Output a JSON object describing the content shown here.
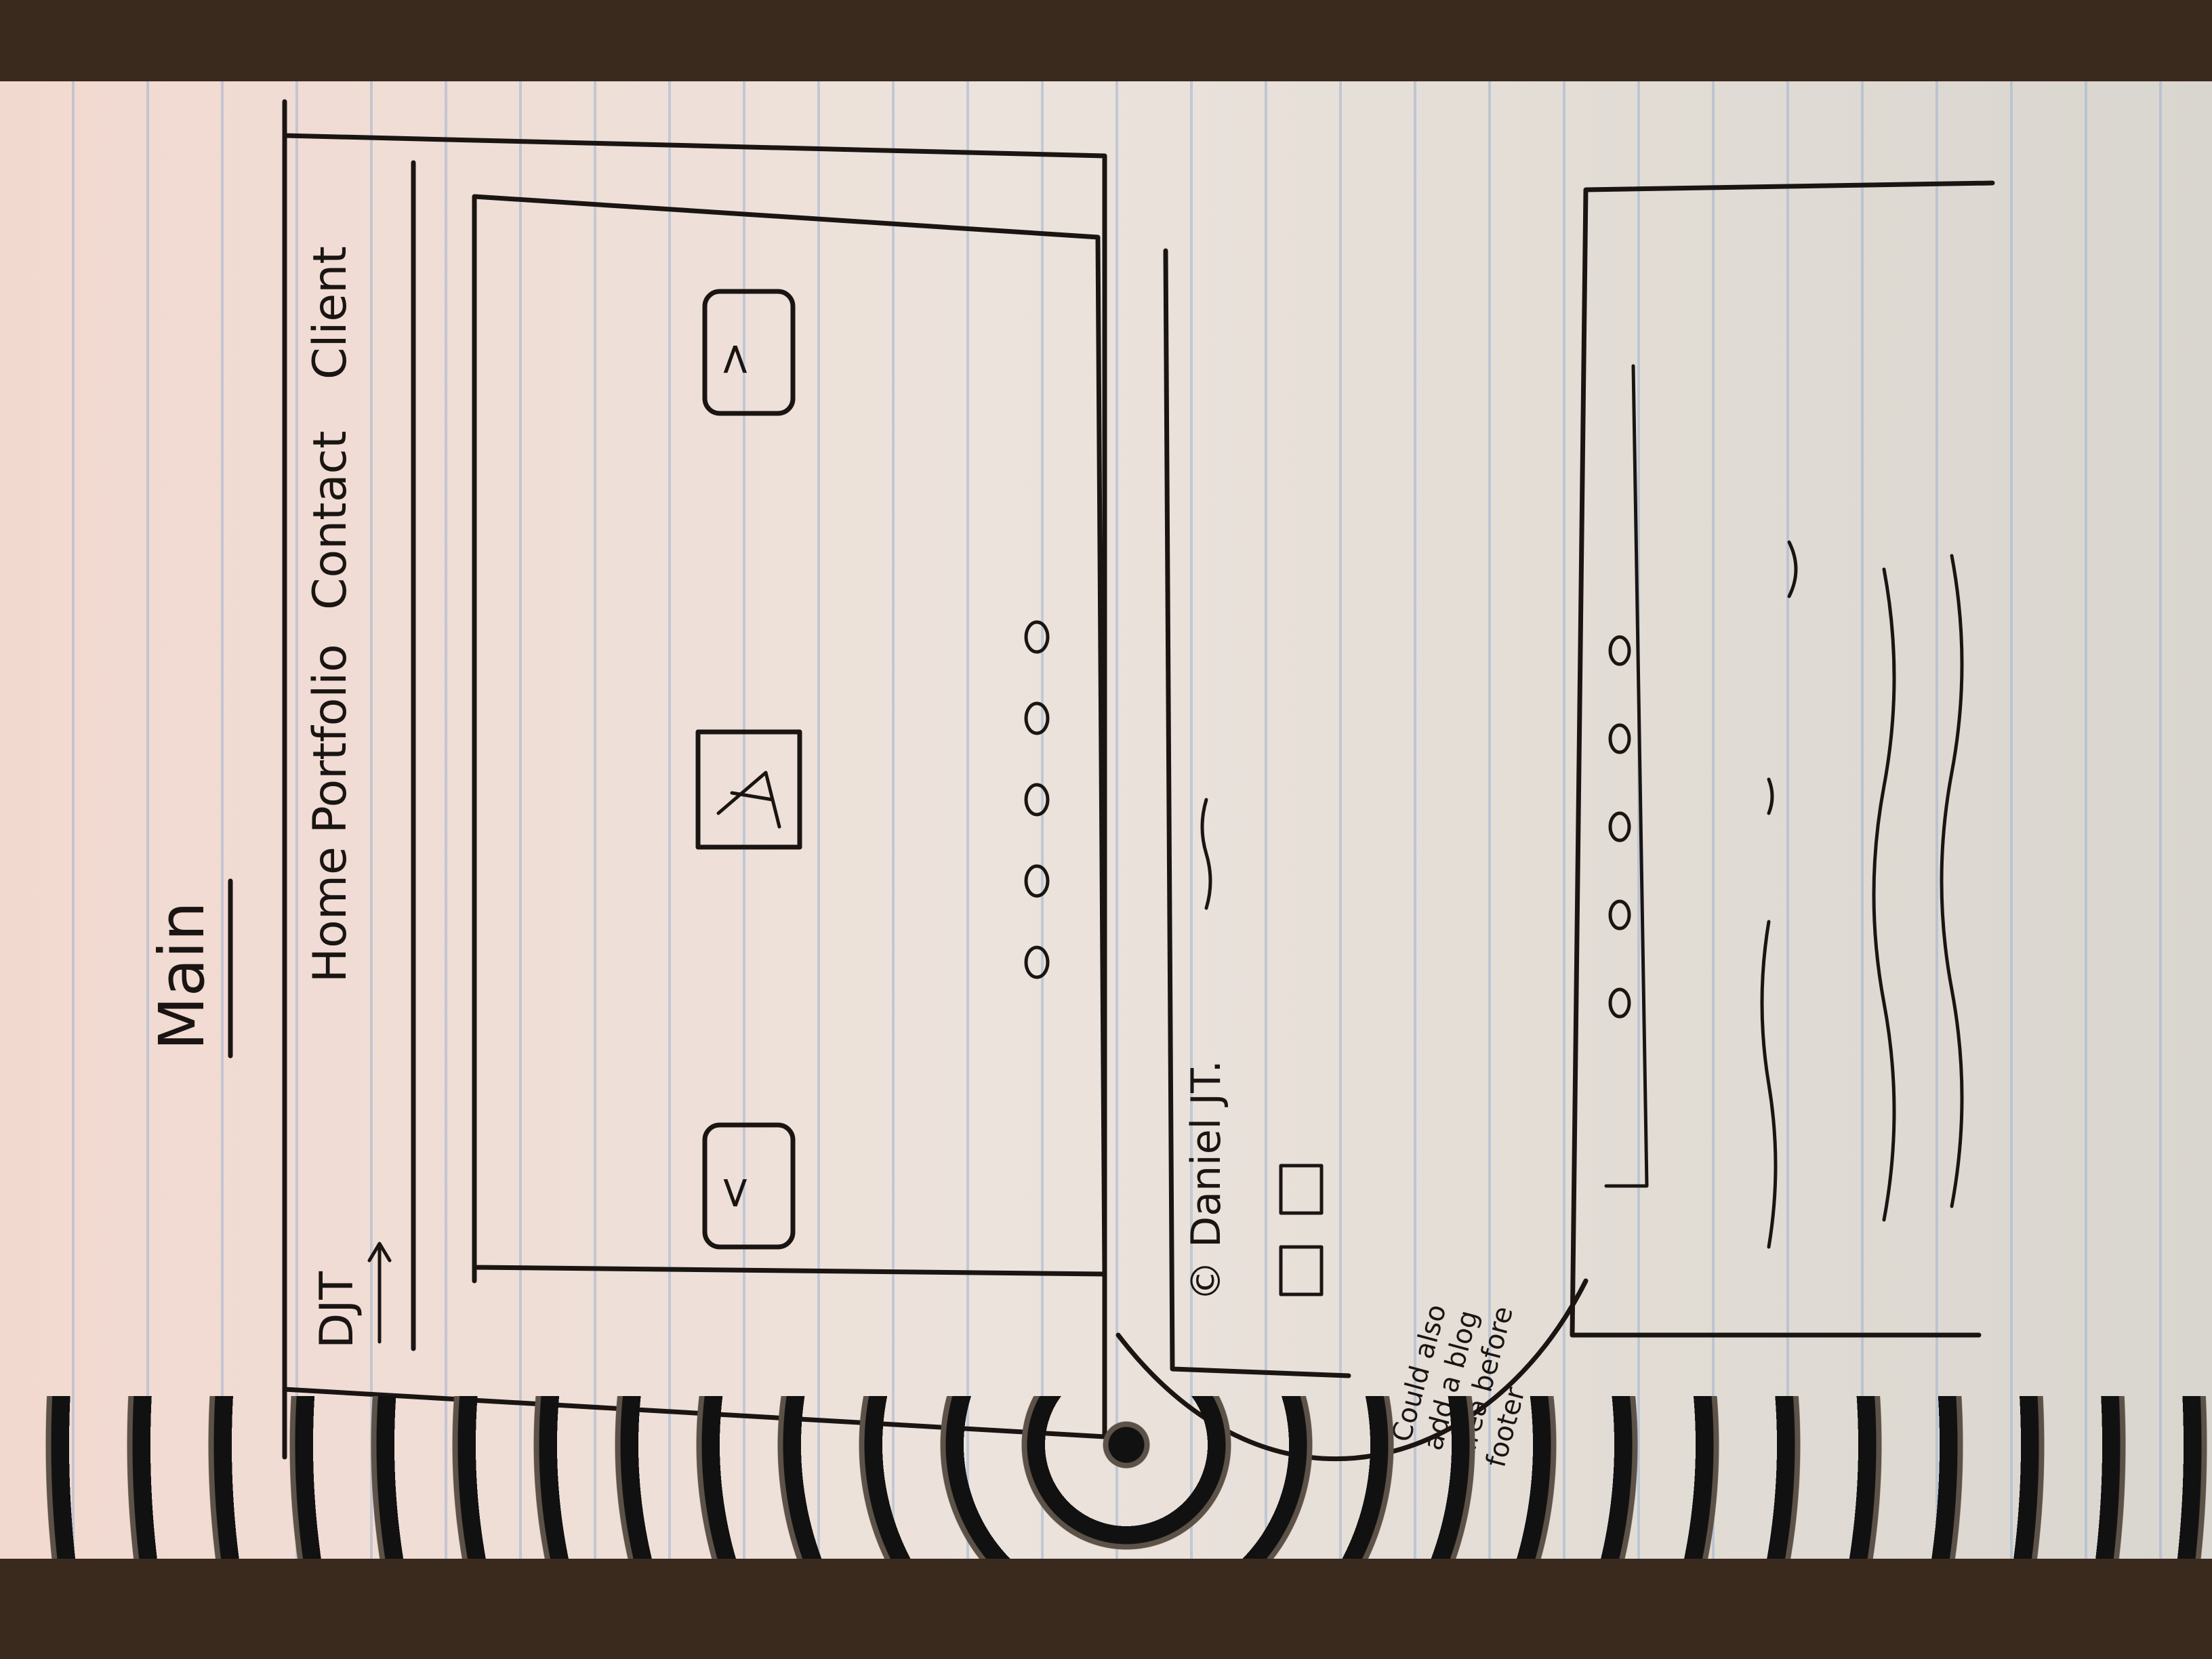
{
  "sketch": {
    "title": "Main",
    "logo": "DJT",
    "nav": {
      "home": "Home",
      "portfolio": "Portfolio",
      "contact": "Contact",
      "client": "Client"
    },
    "slider": {
      "prev": "<",
      "next": ">",
      "dots": 5
    },
    "footer": {
      "credit": "© Daniel JT."
    },
    "note": [
      "Could also",
      "add a blog",
      "area before",
      "footer"
    ]
  }
}
